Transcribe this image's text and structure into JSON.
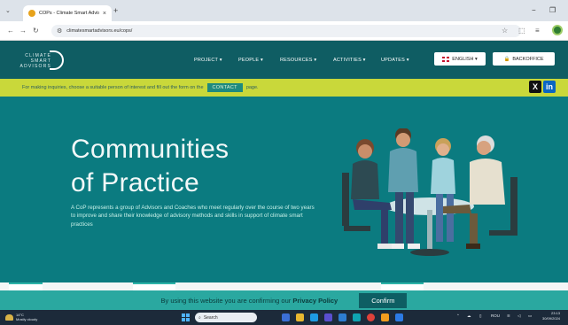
{
  "browser": {
    "tab_title": "COPs - Climate Smart Advisors",
    "tab_close": "×",
    "new_tab": "+",
    "url": "climatesmartadvisors.eu/cops/",
    "window_controls": {
      "minimize": "−",
      "restore": "❐"
    }
  },
  "site": {
    "logo": {
      "line1": "CLIMATE",
      "line2": "SMART",
      "line3": "ADVISORS"
    },
    "nav": [
      {
        "label": "PROJECT ▾"
      },
      {
        "label": "PEOPLE ▾"
      },
      {
        "label": "RESOURCES ▾"
      },
      {
        "label": "ACTIVITIES ▾"
      },
      {
        "label": "UPDATES ▾"
      }
    ],
    "language_button": "ENGLISH ▾",
    "backoffice_button": "BACKOFFICE",
    "notice": {
      "before": "For making inquiries, choose a suitable person of interest and fill out the form on the",
      "contact": "CONTACT",
      "after": "page."
    },
    "social": {
      "x": "X",
      "linkedin": "in"
    },
    "hero": {
      "title_line1": "Communities",
      "title_line2": "of Practice",
      "description": "A CoP represents a group of Advisors and Coaches who meet regularly over the course of two years to improve and share their knowledge of advisory methods and skills in support of climate smart practices"
    },
    "cookie": {
      "message_prefix": "By using this website you are confirming our",
      "policy_link": "Privacy Policy",
      "confirm_button": "Confirm"
    }
  },
  "taskbar": {
    "weather_temp": "14°C",
    "weather_desc": "Mostly cloudy",
    "search_placeholder": "Search",
    "language": "ROU",
    "time": "23:13",
    "date": "30/09/2024"
  },
  "colors": {
    "header": "#0f5d63",
    "notice": "#c9d83a",
    "hero": "#0b7b80",
    "cookie": "#2aa8a0",
    "confirm": "#0e5e63"
  }
}
